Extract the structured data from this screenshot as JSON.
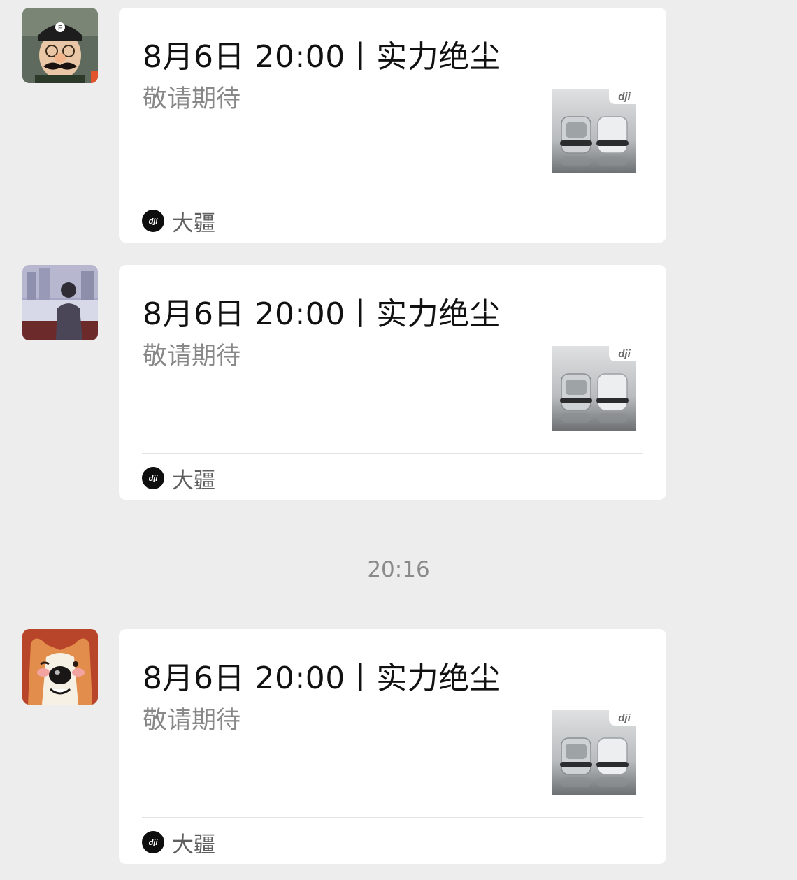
{
  "messages": [
    {
      "avatar": "mustache-man-avatar-icon",
      "card": {
        "title": "8月6日 20:00丨实力绝尘",
        "description": "敬请期待",
        "thumbnail_brand": "dji",
        "source_logo": "dji",
        "source_name": "大疆"
      }
    },
    {
      "avatar": "person-by-water-avatar-icon",
      "card": {
        "title": "8月6日 20:00丨实力绝尘",
        "description": "敬请期待",
        "thumbnail_brand": "dji",
        "source_logo": "dji",
        "source_name": "大疆"
      }
    },
    {
      "avatar": "corgi-avatar-icon",
      "card": {
        "title": "8月6日 20:00丨实力绝尘",
        "description": "敬请期待",
        "thumbnail_brand": "dji",
        "source_logo": "dji",
        "source_name": "大疆"
      }
    }
  ],
  "time_separator": "20:16",
  "colors": {
    "background": "#ededed",
    "card": "#ffffff",
    "title": "#111111",
    "description": "#888888",
    "source_text": "#5f5f5f",
    "timestamp": "#8a8a8a"
  }
}
